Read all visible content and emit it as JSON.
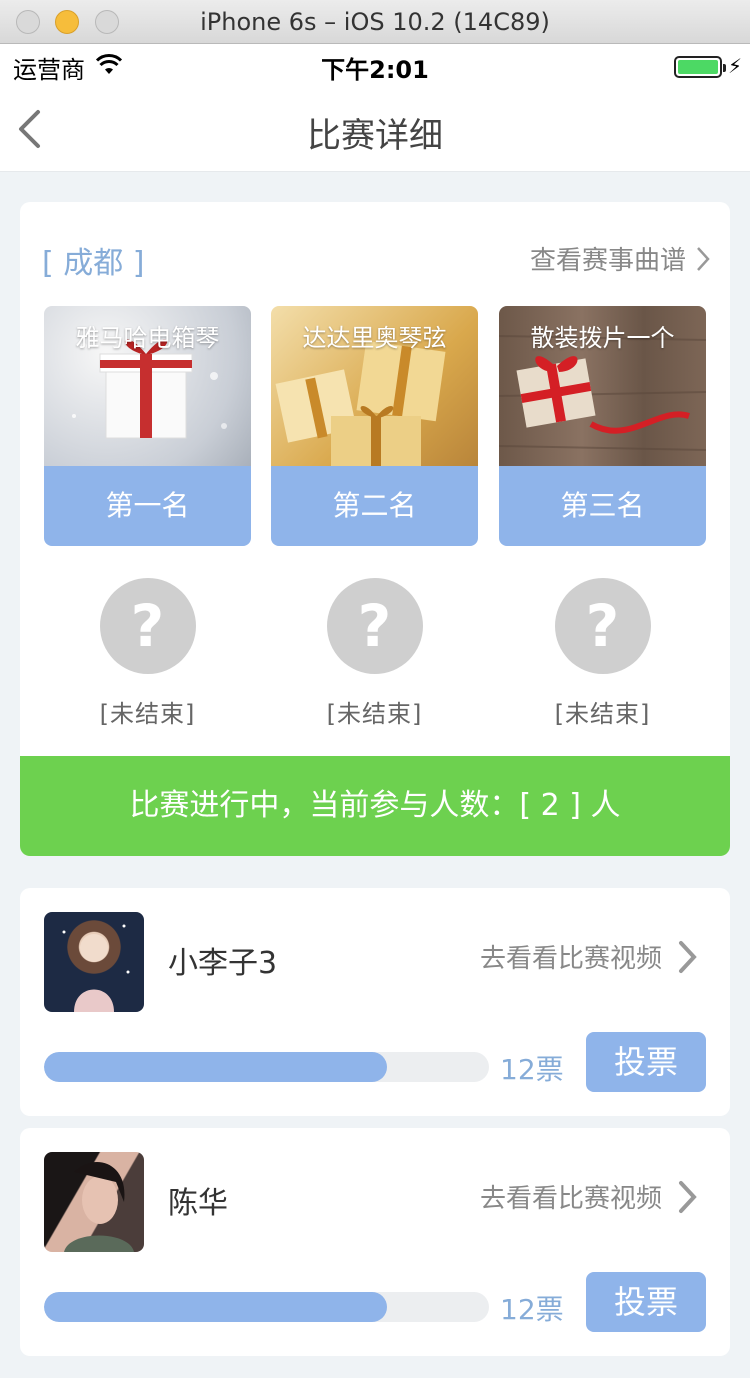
{
  "window": {
    "title": "iPhone 6s – iOS 10.2 (14C89)"
  },
  "status_bar": {
    "carrier": "运营商",
    "time": "下午2:01"
  },
  "nav": {
    "title": "比赛详细"
  },
  "contest": {
    "city": "[ 成都 ]",
    "score_link": "查看赛事曲谱",
    "prizes": [
      {
        "name": "雅马哈电箱琴",
        "rank": "第一名"
      },
      {
        "name": "达达里奥琴弦",
        "rank": "第二名"
      },
      {
        "name": "散装拨片一个",
        "rank": "第三名"
      }
    ],
    "winners": [
      {
        "symbol": "?",
        "status": "[未结束]"
      },
      {
        "symbol": "?",
        "status": "[未结束]"
      },
      {
        "symbol": "?",
        "status": "[未结束]"
      }
    ],
    "status_text": "比赛进行中，当前参与人数：[ 2 ] 人"
  },
  "participants": [
    {
      "name": "小李子3",
      "video_link": "去看看比赛视频",
      "votes_label": "12票",
      "vote_fraction": 0.77,
      "vote_button": "投票"
    },
    {
      "name": "陈华",
      "video_link": "去看看比赛视频",
      "votes_label": "12票",
      "vote_fraction": 0.77,
      "vote_button": "投票"
    }
  ],
  "colors": {
    "accent_blue": "#8fb4ea",
    "status_green": "#6dd14f",
    "placeholder_gray": "#cfcfcf"
  }
}
